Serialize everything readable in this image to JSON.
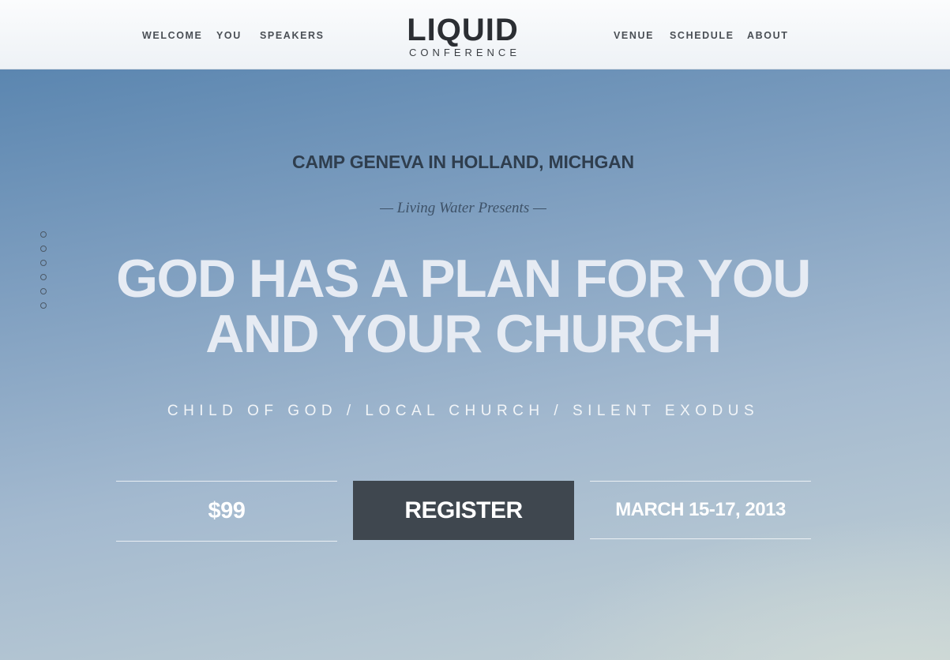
{
  "nav": {
    "left": [
      {
        "label": "WELCOME"
      },
      {
        "label": "YOU"
      },
      {
        "label": "SPEAKERS"
      }
    ],
    "right": [
      {
        "label": "VENUE"
      },
      {
        "label": "SCHEDULE"
      },
      {
        "label": "ABOUT"
      }
    ]
  },
  "logo": {
    "title": "LIQUID",
    "subtitle": "CONFERENCE"
  },
  "hero": {
    "location": "CAMP GENEVA IN HOLLAND, MICHGAN",
    "presents": "— Living Water Presents —",
    "headline_line1": "GOD HAS A PLAN FOR YOU",
    "headline_line2": "AND YOUR CHURCH",
    "tracks": "CHILD OF GOD / LOCAL CHURCH / SILENT EXODUS",
    "price": "$99",
    "register_label": "REGISTER",
    "date": "MARCH 15-17, 2013"
  },
  "section_dots_count": 6,
  "colors": {
    "register_bg": "#3f474f",
    "headline": "#e6ebf3",
    "sky_top": "#5b86b0",
    "sky_bottom": "#c3d0d4"
  }
}
